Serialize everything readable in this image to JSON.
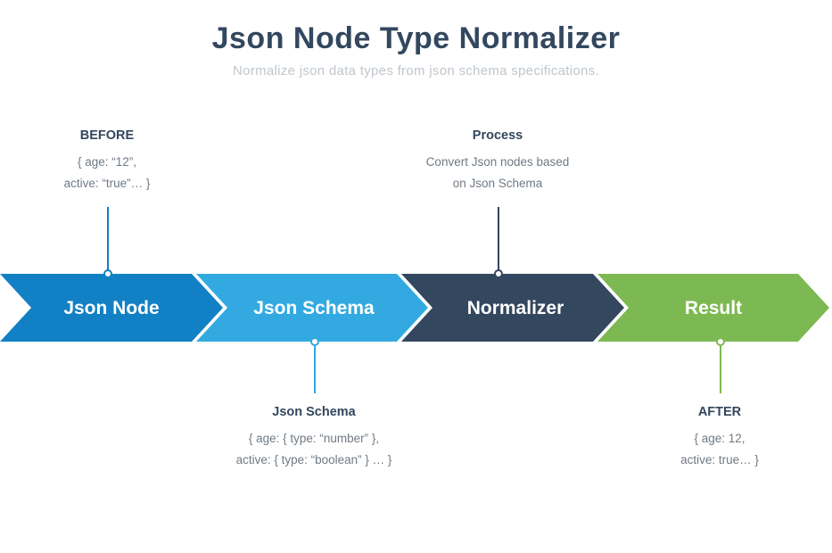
{
  "header": {
    "title": "Json Node Type Normalizer",
    "subtitle": "Normalize json data types from json schema specifications."
  },
  "arrows": {
    "a1": {
      "label": "Json Node",
      "color": "#1280c4"
    },
    "a2": {
      "label": "Json Schema",
      "color": "#32aae1"
    },
    "a3": {
      "label": "Normalizer",
      "color": "#33475f"
    },
    "a4": {
      "label": "Result",
      "color": "#7db952"
    }
  },
  "callouts": {
    "before": {
      "head": "BEFORE",
      "line1": "{ age: “12”,",
      "line2": "active: “true”… }"
    },
    "process": {
      "head": "Process",
      "line1": "Convert Json nodes based",
      "line2": "on Json Schema"
    },
    "schema": {
      "head": "Json Schema",
      "line1": "{ age: { type: “number” },",
      "line2": "active: { type: “boolean” } … }"
    },
    "after": {
      "head": "AFTER",
      "line1": "{ age: 12,",
      "line2": "active: true… }"
    }
  }
}
